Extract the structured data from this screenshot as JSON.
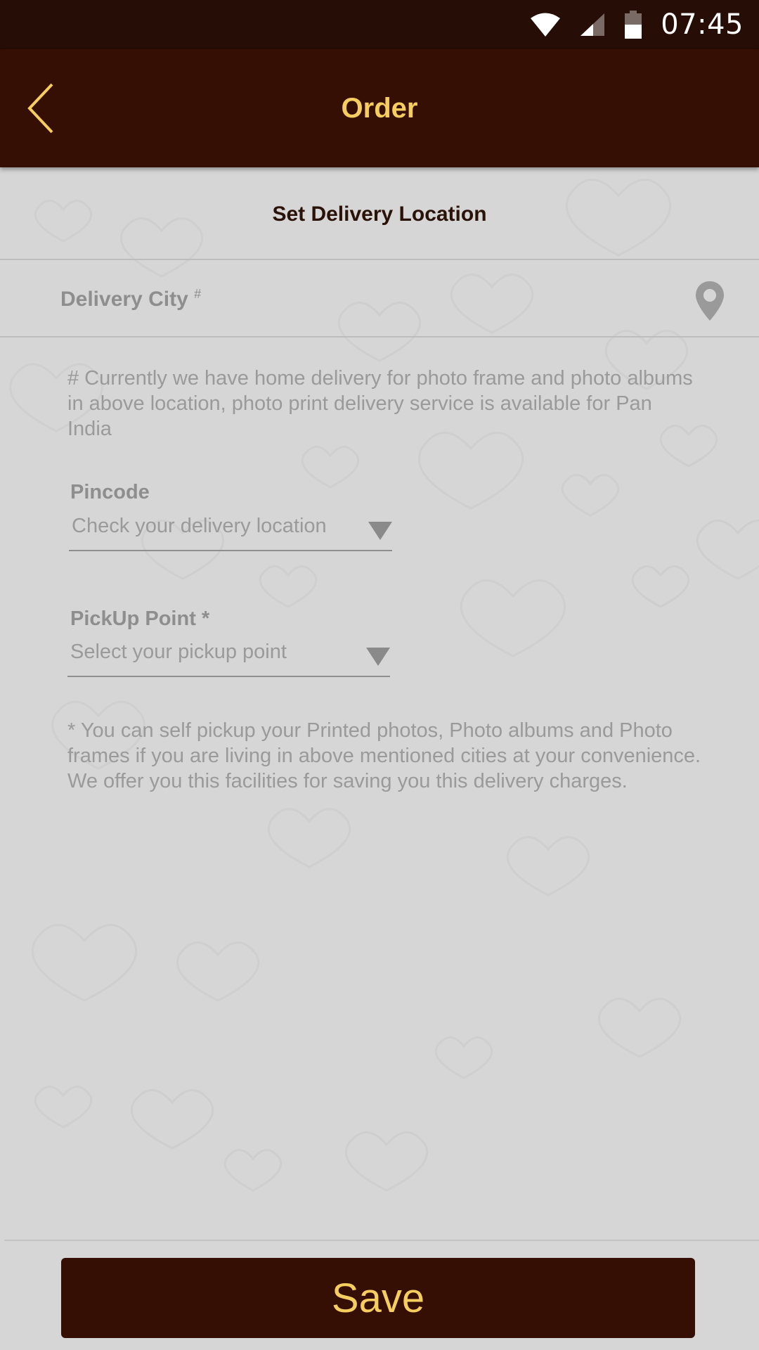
{
  "status_bar": {
    "time": "07:45",
    "icons": [
      "wifi-icon",
      "signal-icon",
      "battery-icon"
    ]
  },
  "app_bar": {
    "title": "Order",
    "back_icon": "chevron-left-icon"
  },
  "form": {
    "section_title": "Set Delivery Location",
    "delivery_city": {
      "label": "Delivery City",
      "marker": "#",
      "icon": "location-pin-icon"
    },
    "delivery_note": "# Currently we have home delivery for photo frame and photo albums in above location, photo print delivery service is available for Pan India",
    "pincode": {
      "label": "Pincode",
      "placeholder": "Check your delivery location"
    },
    "pickup_point": {
      "label": "PickUp Point *",
      "placeholder": "Select your pickup point"
    },
    "pickup_note": "* You can self pickup your Printed photos, Photo albums and Photo frames if you are living in above mentioned cities at your convenience. We offer you this facilities for saving you this delivery charges."
  },
  "footer": {
    "save_label": "Save"
  },
  "colors": {
    "status_bar": "#260d05",
    "app_bar": "#360f04",
    "accent": "#f6cd5f",
    "background": "#d6d6d6"
  }
}
